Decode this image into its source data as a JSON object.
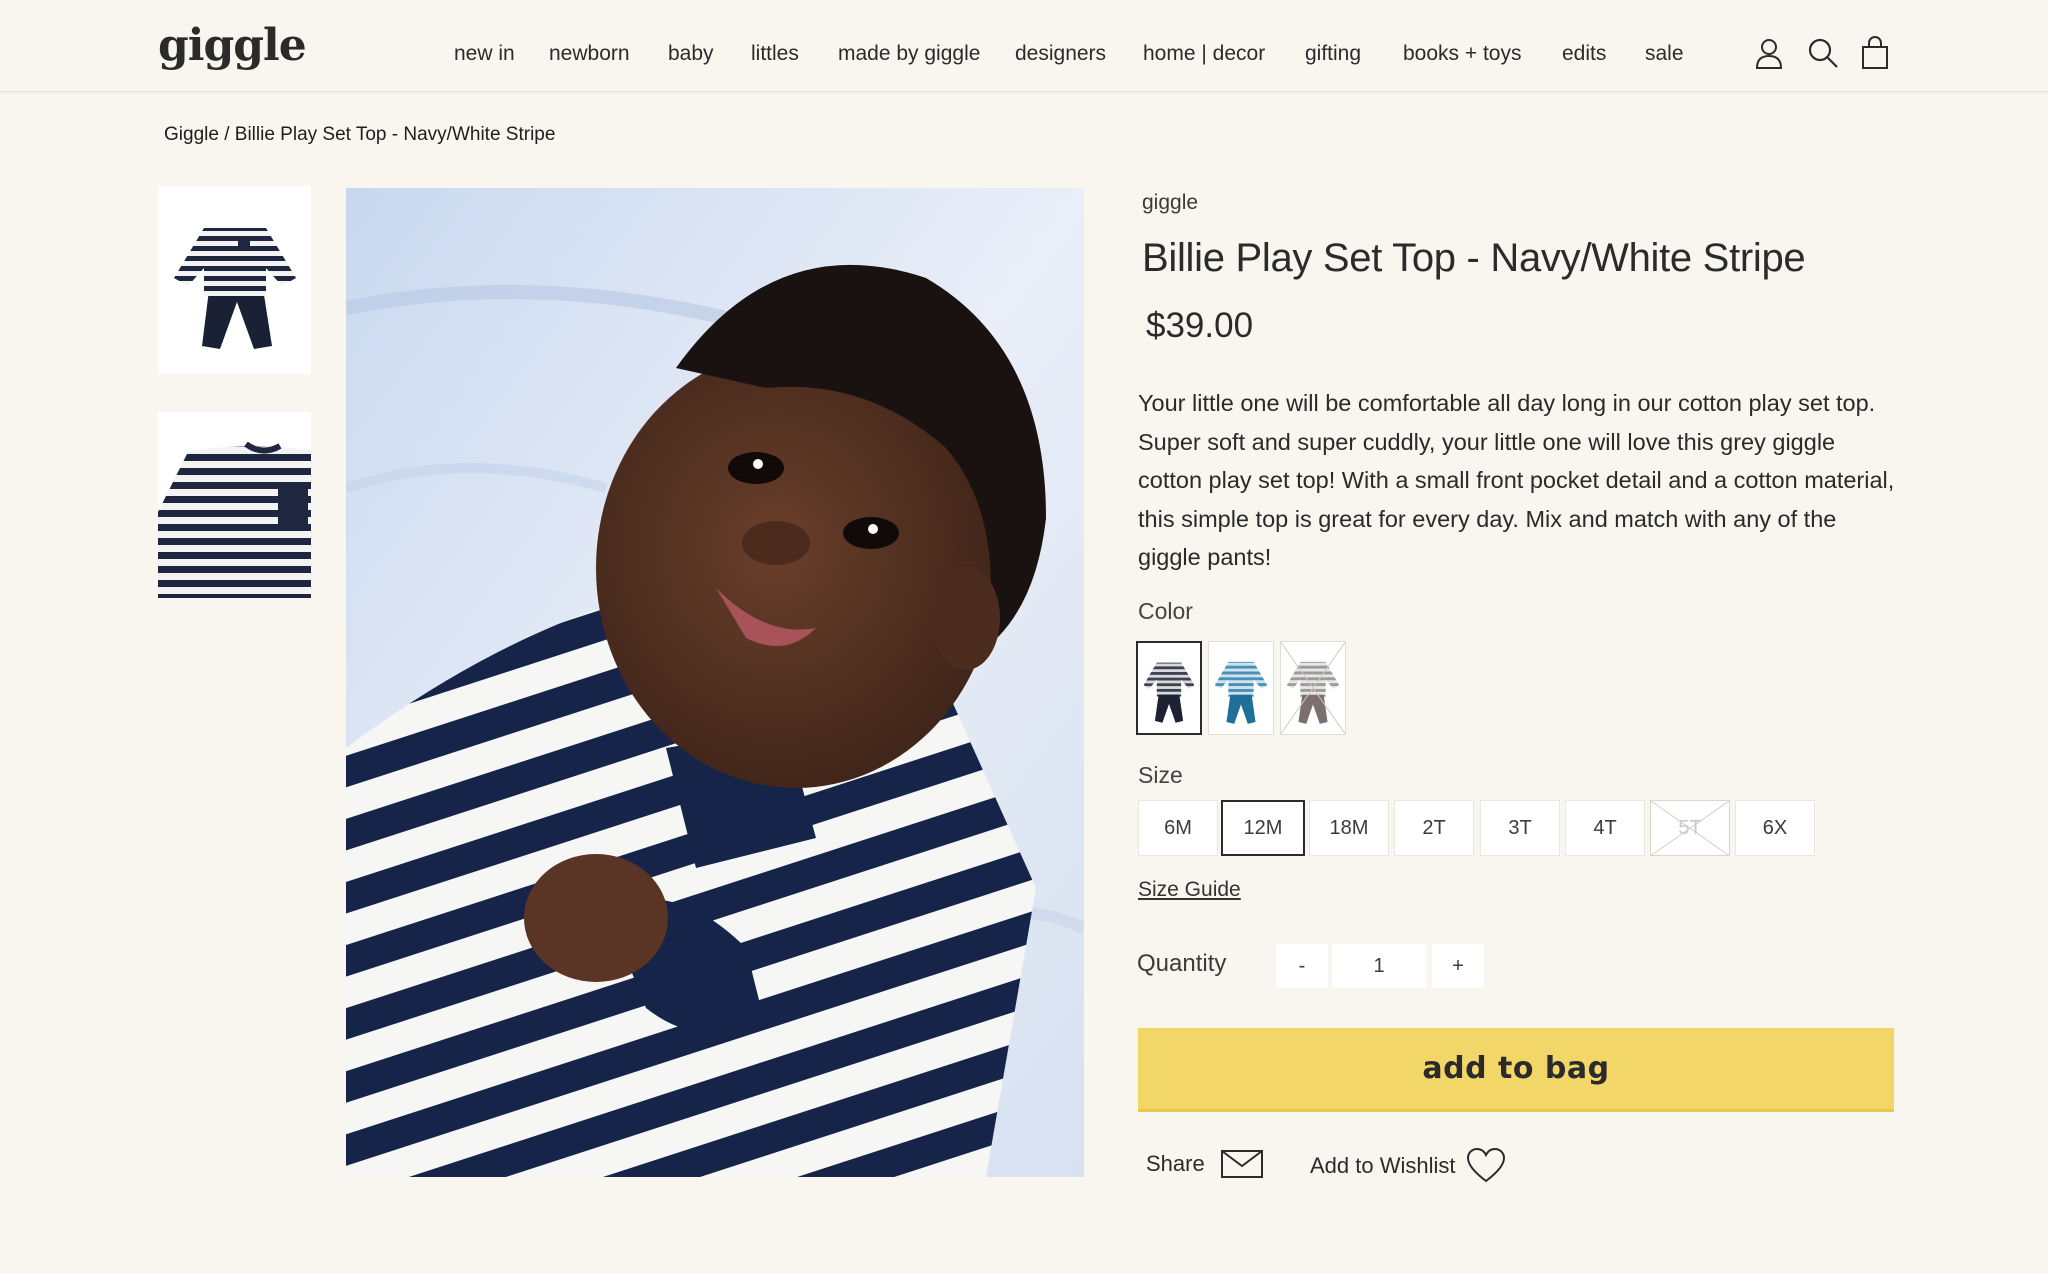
{
  "header": {
    "logo": "giggle",
    "nav": [
      "new in",
      "newborn",
      "baby",
      "littles",
      "made by giggle",
      "designers",
      "home | decor",
      "gifting",
      "books + toys",
      "edits",
      "sale"
    ],
    "icons": [
      "account-icon",
      "search-icon",
      "bag-icon"
    ]
  },
  "breadcrumb": {
    "home": "Giggle",
    "separator": " / ",
    "current": "Billie Play Set Top - Navy/White Stripe"
  },
  "gallery": {
    "thumbnails": [
      "outfit-set-thumbnail",
      "sweater-closeup-thumbnail"
    ],
    "main_image": "smiling-baby-in-striped-sweater"
  },
  "product": {
    "brand": "giggle",
    "title": "Billie Play Set Top - Navy/White Stripe",
    "price": "$39.00",
    "description": "Your little one will be comfortable all day long in our cotton play set top. Super soft and super cuddly, your little one will love this grey giggle cotton play set top! With a small front pocket detail and a cotton material, this simple top is great for every day. Mix and match with any of the giggle pants!",
    "color_label": "Color",
    "colors": [
      {
        "name": "navy",
        "top": "#3b4254",
        "stripe": "#d9d9d9",
        "pants": "#1d2233",
        "selected": true
      },
      {
        "name": "blue",
        "top": "#4b8fb8",
        "stripe": "#cfe3ee",
        "pants": "#1f6f98",
        "selected": false
      },
      {
        "name": "grey",
        "top": "#9d9a9b",
        "stripe": "#e8e6e6",
        "pants": "#7b7070",
        "selected": false,
        "unavailable": true
      }
    ],
    "size_label": "Size",
    "sizes": [
      {
        "label": "6M",
        "selected": false,
        "available": true
      },
      {
        "label": "12M",
        "selected": true,
        "available": true
      },
      {
        "label": "18M",
        "selected": false,
        "available": true
      },
      {
        "label": "2T",
        "selected": false,
        "available": true
      },
      {
        "label": "3T",
        "selected": false,
        "available": true
      },
      {
        "label": "4T",
        "selected": false,
        "available": true
      },
      {
        "label": "5T",
        "selected": false,
        "available": false
      },
      {
        "label": "6X",
        "selected": false,
        "available": true
      }
    ],
    "size_guide": "Size Guide",
    "quantity_label": "Quantity",
    "quantity_value": "1",
    "minus": "-",
    "plus": "+",
    "add_to_bag": "add to bag",
    "share": "Share",
    "wishlist": "Add to Wishlist"
  },
  "colors": {
    "background": "#f9f6ef",
    "accent": "#f2d668",
    "text": "#2b2b2b"
  }
}
